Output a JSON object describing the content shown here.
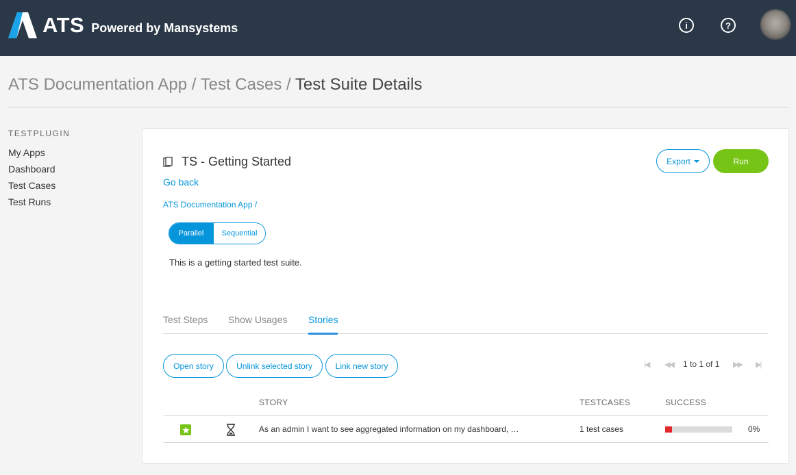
{
  "header": {
    "logo_text": "ATS",
    "powered_text": "Powered by Mansystems",
    "info_icon": "info-circle-icon",
    "help_icon": "question-circle-icon",
    "bg_color": "#2a3847"
  },
  "breadcrumb": {
    "part1": "ATS Documentation App",
    "sep": " / ",
    "part2": "Test Cases",
    "current": "Test Suite Details"
  },
  "sidebar": {
    "heading": "TESTPLUGIN",
    "items": [
      {
        "label": "My Apps"
      },
      {
        "label": "Dashboard"
      },
      {
        "label": "Test Cases"
      },
      {
        "label": "Test Runs"
      }
    ]
  },
  "suite": {
    "title": "TS - Getting Started",
    "go_back": "Go back",
    "app_crumb": "ATS Documentation App /",
    "mode_parallel": "Parallel",
    "mode_sequential": "Sequential",
    "mode_selected": "Parallel",
    "description": "This is a getting started test suite.",
    "export_label": "Export",
    "run_label": "Run"
  },
  "tabs": [
    {
      "label": "Test Steps"
    },
    {
      "label": "Show Usages"
    },
    {
      "label": "Stories",
      "active": true
    }
  ],
  "actions": {
    "open_story": "Open story",
    "unlink_story": "Unlink selected story",
    "link_story": "Link new story"
  },
  "pager": {
    "text": "1 to 1 of 1"
  },
  "table": {
    "headers": {
      "story": "STORY",
      "testcases": "TESTCASES",
      "success": "SUCCESS"
    },
    "rows": [
      {
        "story": "As an admin I want to see aggregated information on my dashboard, …",
        "testcases": "1 test cases",
        "success_pct": "0%",
        "success_fraction": 0.0,
        "fail_fraction": 0.1
      }
    ]
  },
  "colors": {
    "accent": "#0595db",
    "run_green": "#76c415",
    "fail_red": "#e0272b"
  }
}
